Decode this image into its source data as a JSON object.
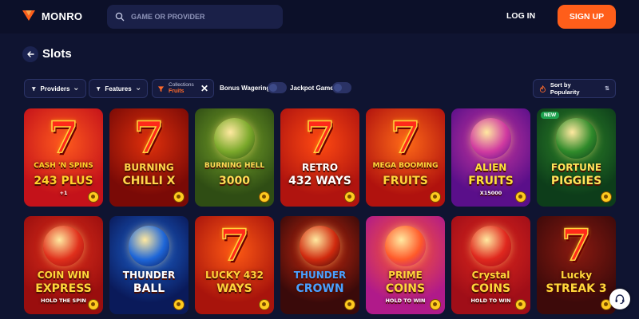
{
  "header": {
    "brand": "MONRO",
    "search_placeholder": "GAME OR PROVIDER",
    "login_label": "LOG IN",
    "signup_label": "SIGN UP"
  },
  "page": {
    "title": "Slots"
  },
  "filters": {
    "providers_label": "Providers",
    "features_label": "Features",
    "collections_label": "Collections",
    "collections_value": "Fruits",
    "bonus_wagering_label": "Bonus Wagering",
    "jackpot_games_label": "Jackpot Games",
    "sort_label": "Sort by Popularity"
  },
  "games": [
    {
      "title": "CASH 'N SPINS 243 PLUS",
      "line1": "CASH 'N SPINS",
      "line2": "243 PLUS",
      "extra": "+1",
      "has_seven": true,
      "bg": "#c4121a",
      "bg2": "#ff5a1e",
      "text_color": "#ffd22a",
      "new": false
    },
    {
      "title": "BURNING CHILLI X",
      "line1": "BURNING",
      "line2": "CHILLI X",
      "extra": "",
      "has_seven": true,
      "bg": "#7a0a06",
      "bg2": "#e0300c",
      "text_color": "#ffd54a",
      "new": false
    },
    {
      "title": "BURNING HELL 3000",
      "line1": "BURNING HELL",
      "line2": "3000",
      "extra": "",
      "has_seven": false,
      "bg": "#2f4d14",
      "bg2": "#7aa82a",
      "text_color": "#ffdd55",
      "new": false
    },
    {
      "title": "RETRO 432 WAYS",
      "line1": "RETRO",
      "line2": "432 WAYS",
      "extra": "",
      "has_seven": true,
      "bg": "#b0140f",
      "bg2": "#ff4a12",
      "text_color": "#ffffff",
      "new": false
    },
    {
      "title": "MEGA BOOMING FRUITS",
      "line1": "MEGA BOOMING",
      "line2": "FRUITS",
      "extra": "",
      "has_seven": true,
      "bg": "#b0120e",
      "bg2": "#ff6a18",
      "text_color": "#ffd63a",
      "new": false
    },
    {
      "title": "ALIEN FRUITS X15000",
      "line1": "ALIEN",
      "line2": "FRUITS",
      "extra": "X15000",
      "has_seven": false,
      "bg": "#5a0f8a",
      "bg2": "#d03aa0",
      "text_color": "#ffe23a",
      "new": false
    },
    {
      "title": "FORTUNE PIGGIES",
      "line1": "FORTUNE",
      "line2": "PIGGIES",
      "extra": "",
      "has_seven": false,
      "bg": "#0d3d1a",
      "bg2": "#2f8a2a",
      "text_color": "#ffe35a",
      "new": true
    },
    {
      "title": "COIN WIN EXPRESS HOLD THE SPIN",
      "line1": "COIN WIN",
      "line2": "EXPRESS",
      "extra": "HOLD THE SPIN",
      "has_seven": false,
      "bg": "#9a0e0e",
      "bg2": "#e0301c",
      "text_color": "#ffd63a",
      "new": false
    },
    {
      "title": "THUNDER BALL",
      "line1": "THUNDER",
      "line2": "BALL",
      "extra": "",
      "has_seven": false,
      "bg": "#0a1a5a",
      "bg2": "#1e66d8",
      "text_color": "#ffffff",
      "new": false
    },
    {
      "title": "LUCKY 432 WAYS",
      "line1": "LUCKY 432",
      "line2": "WAYS",
      "extra": "",
      "has_seven": true,
      "bg": "#a8140c",
      "bg2": "#ff5a14",
      "text_color": "#ffd23a",
      "new": false
    },
    {
      "title": "THUNDER CROWN",
      "line1": "THUNDER",
      "line2": "CROWN",
      "extra": "",
      "has_seven": false,
      "bg": "#3a0a0a",
      "bg2": "#d02a0e",
      "text_color": "#4aa0ff",
      "new": false
    },
    {
      "title": "PRIME COINS HOLD TO WIN",
      "line1": "PRIME",
      "line2": "COINS",
      "extra": "HOLD TO WIN",
      "has_seven": false,
      "bg": "#b01a8a",
      "bg2": "#ff5a2a",
      "text_color": "#ffd63a",
      "new": false
    },
    {
      "title": "CRYSTAL COINS HOLD TO WIN",
      "line1": "Crystal",
      "line2": "COINS",
      "extra": "HOLD TO WIN",
      "has_seven": false,
      "bg": "#a00e18",
      "bg2": "#e0281e",
      "text_color": "#ffd63a",
      "new": false
    },
    {
      "title": "LUCKY STREAK 3",
      "line1": "Lucky",
      "line2": "STREAK 3",
      "extra": "",
      "has_seven": true,
      "bg": "#3d0a0a",
      "bg2": "#8a1a10",
      "text_color": "#ffd63a",
      "new": false
    }
  ],
  "badges": {
    "new_label": "NEW"
  },
  "colors": {
    "background": "#0f1431",
    "accent": "#ff5e1a",
    "panel": "#161b3f"
  }
}
